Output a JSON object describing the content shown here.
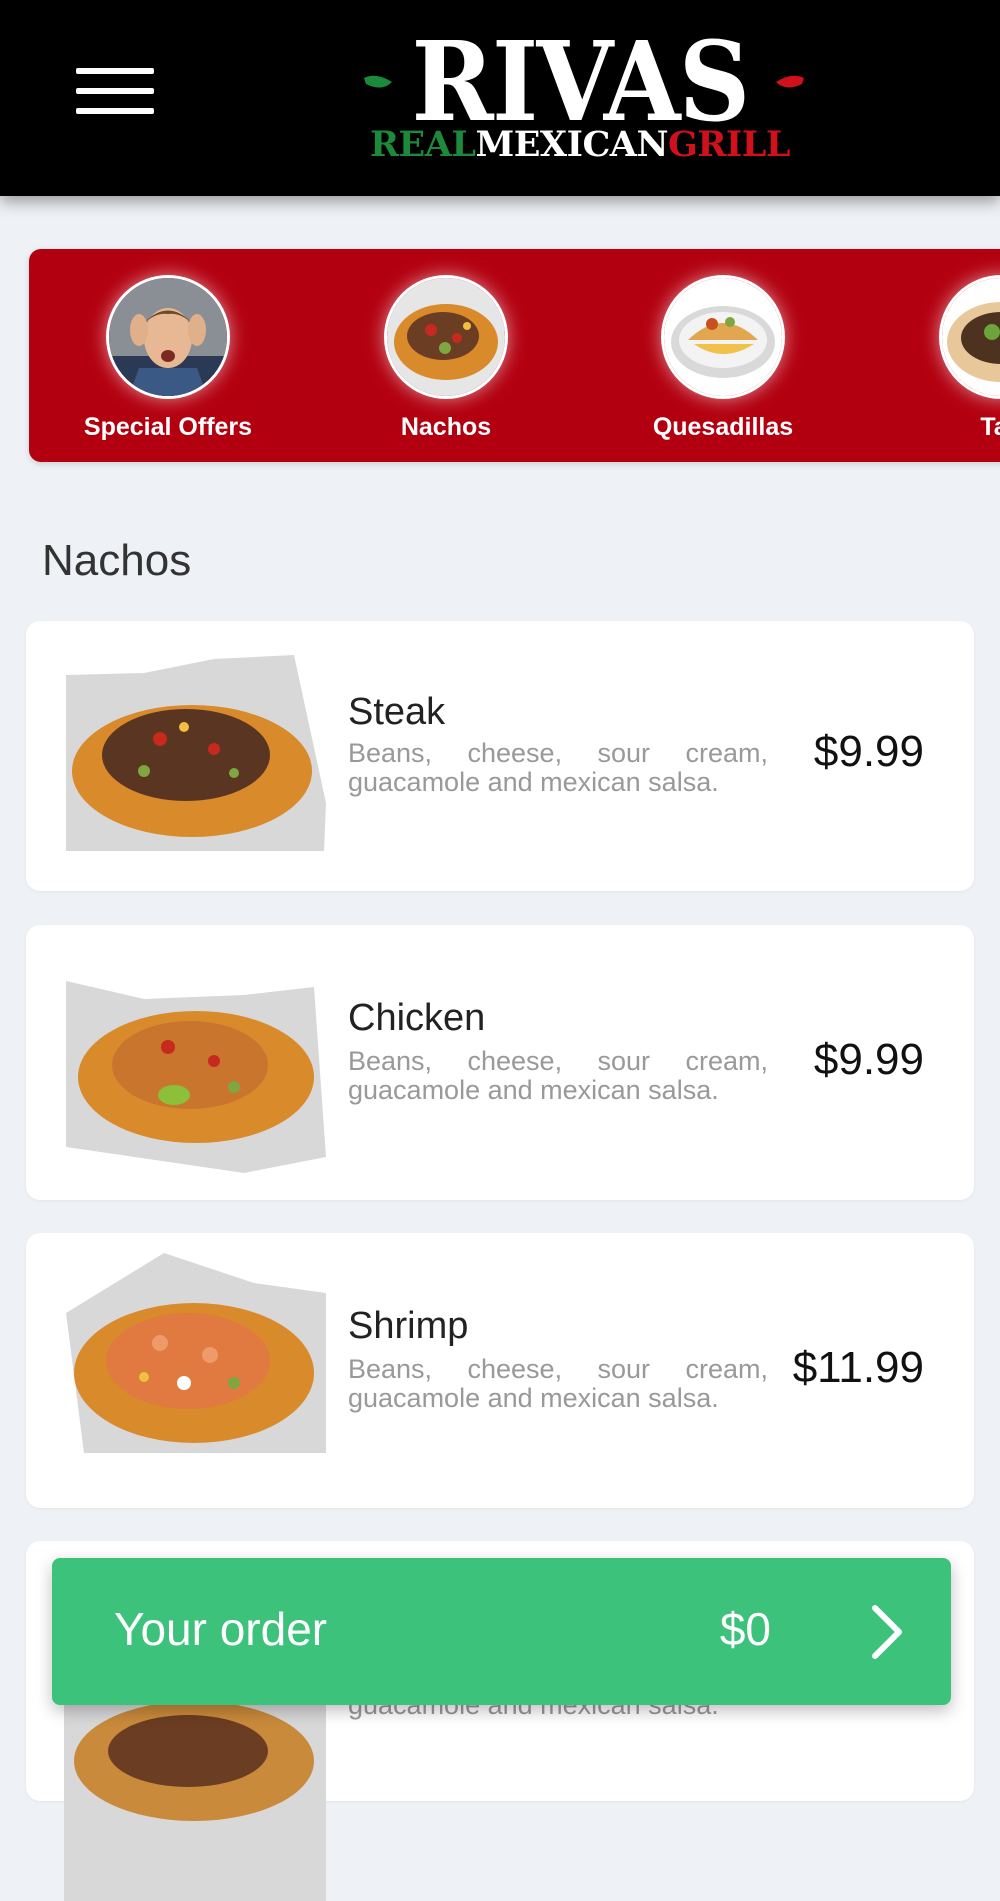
{
  "header": {
    "menu_icon": "hamburger-menu-icon",
    "logo": {
      "main": "RIVAS",
      "sub_part1": "REAL",
      "sub_part2": "MEXICAN",
      "sub_part3": "GRILL",
      "colors": {
        "green": "#1b8a3a",
        "white": "#ffffff",
        "red": "#d0101a"
      }
    }
  },
  "categories": [
    {
      "label": "Special Offers"
    },
    {
      "label": "Nachos"
    },
    {
      "label": "Quesadillas"
    },
    {
      "label": "Tac"
    }
  ],
  "section": {
    "title": "Nachos"
  },
  "items": [
    {
      "name": "Steak",
      "description": "Beans, cheese, sour cream, guacamole and mexican salsa.",
      "price": "$9.99"
    },
    {
      "name": "Chicken",
      "description": "Beans, cheese, sour cream, guacamole and mexican salsa.",
      "price": "$9.99"
    },
    {
      "name": "Shrimp",
      "description": "Beans, cheese, sour cream, guacamole and mexican salsa.",
      "price": "$11.99"
    },
    {
      "name": "",
      "description": "guacamole and mexican salsa.",
      "price": ""
    }
  ],
  "order_bar": {
    "label": "Your order",
    "total": "$0",
    "arrow_icon": "chevron-right-icon"
  },
  "colors": {
    "header_bg": "#000000",
    "category_bg": "#b30010",
    "order_bar": "#3cc27b",
    "page_bg": "#eef1f5"
  }
}
